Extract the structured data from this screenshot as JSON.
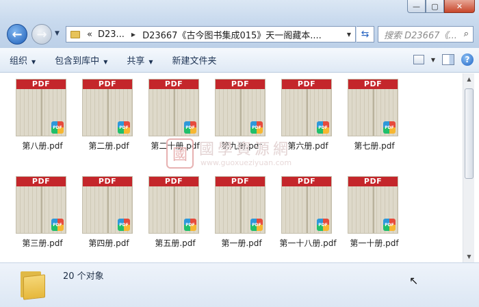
{
  "window": {
    "minimize": "—",
    "maximize": "▢",
    "close": "✕"
  },
  "address": {
    "crumb1": "D23...",
    "crumb2": "D23667《古今图书集成015》天一阁藏本....",
    "search_placeholder": "搜索 D23667《..."
  },
  "toolbar": {
    "organize": "组织",
    "include_library": "包含到库中",
    "share": "共享",
    "new_folder": "新建文件夹"
  },
  "files": [
    {
      "name": "第八册.pdf",
      "label": "PDF"
    },
    {
      "name": "第二册.pdf",
      "label": "PDF"
    },
    {
      "name": "第二十册.pdf",
      "label": "PDF"
    },
    {
      "name": "第九册.pdf",
      "label": "PDF"
    },
    {
      "name": "第六册.pdf",
      "label": "PDF"
    },
    {
      "name": "第七册.pdf",
      "label": "PDF"
    },
    {
      "name": "第三册.pdf",
      "label": "PDF"
    },
    {
      "name": "第四册.pdf",
      "label": "PDF"
    },
    {
      "name": "第五册.pdf",
      "label": "PDF"
    },
    {
      "name": "第一册.pdf",
      "label": "PDF"
    },
    {
      "name": "第一十八册.pdf",
      "label": "PDF"
    },
    {
      "name": "第一十册.pdf",
      "label": "PDF"
    }
  ],
  "badge_text": "PDF",
  "watermark": {
    "title": "國學資源網",
    "url": "www.guoxueziyuan.com",
    "seal": "國"
  },
  "status": {
    "count": "20 个对象"
  }
}
